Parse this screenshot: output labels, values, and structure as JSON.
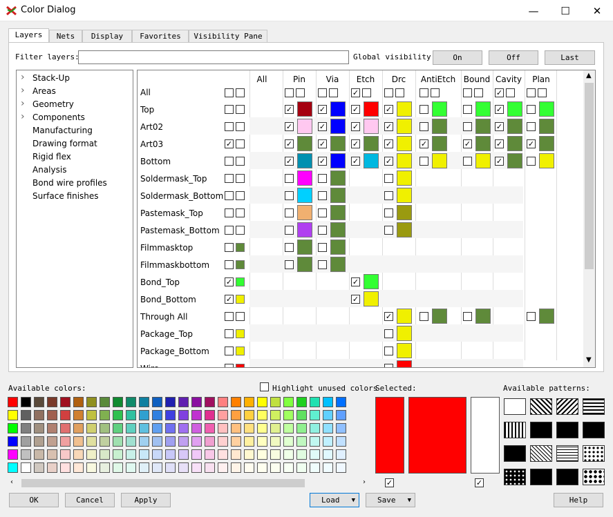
{
  "window": {
    "title": "Color Dialog",
    "minimize": "—",
    "maximize": "☐",
    "close": "✕"
  },
  "tabs": [
    "Layers",
    "Nets",
    "Display",
    "Favorites",
    "Visibility Pane"
  ],
  "filter": {
    "label": "Filter layers:",
    "value": ""
  },
  "global_visibility": {
    "label": "Global visibility:",
    "on": "On",
    "off": "Off",
    "last": "Last"
  },
  "tree": [
    {
      "label": "Stack-Up",
      "expandable": true
    },
    {
      "label": "Areas",
      "expandable": true
    },
    {
      "label": "Geometry",
      "expandable": true
    },
    {
      "label": "Components",
      "expandable": true
    },
    {
      "label": "Manufacturing",
      "expandable": false
    },
    {
      "label": "Drawing format",
      "expandable": false
    },
    {
      "label": "Rigid flex",
      "expandable": false
    },
    {
      "label": "Analysis",
      "expandable": false
    },
    {
      "label": "Bond wire profiles",
      "expandable": false
    },
    {
      "label": "Surface finishes",
      "expandable": false
    }
  ],
  "columns": [
    "All",
    "Pin",
    "Via",
    "Etch",
    "Drc",
    "AntiEtch",
    "Bound",
    "Cavity",
    "Plan"
  ],
  "rows": [
    {
      "name": "All",
      "all": [
        0,
        0
      ],
      "cells": [
        [
          0,
          null
        ],
        [
          0,
          null
        ],
        [
          1,
          null
        ],
        [
          0,
          null
        ],
        [
          0,
          null
        ],
        [
          0,
          null
        ],
        [
          1,
          null
        ],
        [
          0,
          null
        ]
      ]
    },
    {
      "name": "Top",
      "all": [
        0,
        0
      ],
      "cells": [
        [
          1,
          "#a50010"
        ],
        [
          1,
          "#0000ff"
        ],
        [
          1,
          "#ff0000"
        ],
        [
          1,
          "#f0f000"
        ],
        [
          0,
          "#33ff33"
        ],
        [
          0,
          "#33ff33"
        ],
        [
          1,
          "#33ff33"
        ],
        [
          0,
          "#33ff33"
        ]
      ]
    },
    {
      "name": "Art02",
      "all": [
        0,
        0
      ],
      "cells": [
        [
          1,
          "#ffc8f0"
        ],
        [
          1,
          "#0000ff"
        ],
        [
          1,
          "#ffc8f0"
        ],
        [
          1,
          "#f0f000"
        ],
        [
          0,
          "#5f8a3a"
        ],
        [
          0,
          "#5f8a3a"
        ],
        [
          1,
          "#5f8a3a"
        ],
        [
          0,
          "#5f8a3a"
        ]
      ]
    },
    {
      "name": "Art03",
      "all": [
        1,
        0
      ],
      "cells": [
        [
          1,
          "#5f8a3a"
        ],
        [
          1,
          "#5f8a3a"
        ],
        [
          1,
          "#5f8a3a"
        ],
        [
          1,
          "#f0f000"
        ],
        [
          1,
          "#5f8a3a"
        ],
        [
          1,
          "#5f8a3a"
        ],
        [
          1,
          "#5f8a3a"
        ],
        [
          1,
          "#5f8a3a"
        ]
      ]
    },
    {
      "name": "Bottom",
      "all": [
        0,
        0
      ],
      "cells": [
        [
          1,
          "#0090b0"
        ],
        [
          1,
          "#0000ff"
        ],
        [
          1,
          "#00b8e0"
        ],
        [
          1,
          "#f0f000"
        ],
        [
          0,
          "#f0f000"
        ],
        [
          0,
          "#f0f000"
        ],
        [
          1,
          "#5f8a3a"
        ],
        [
          0,
          "#f0f000"
        ]
      ]
    },
    {
      "name": "Soldermask_Top",
      "all": [
        0,
        0
      ],
      "cells": [
        [
          0,
          "#ff00ff"
        ],
        [
          0,
          "#5f8a3a"
        ],
        null,
        [
          0,
          "#f0f000"
        ],
        null,
        null,
        null,
        null
      ]
    },
    {
      "name": "Soldermask_Bottom",
      "all": [
        0,
        0
      ],
      "cells": [
        [
          0,
          "#00d0ff"
        ],
        [
          0,
          "#5f8a3a"
        ],
        null,
        [
          0,
          "#f0f000"
        ],
        null,
        null,
        null,
        null
      ]
    },
    {
      "name": "Pastemask_Top",
      "all": [
        0,
        0
      ],
      "cells": [
        [
          0,
          "#f0b070"
        ],
        [
          0,
          "#5f8a3a"
        ],
        null,
        [
          0,
          "#9a9a10"
        ],
        null,
        null,
        null,
        null
      ]
    },
    {
      "name": "Pastemask_Bottom",
      "all": [
        0,
        0
      ],
      "cells": [
        [
          0,
          "#b040f0"
        ],
        [
          0,
          "#5f8a3a"
        ],
        null,
        [
          0,
          "#9a9a10"
        ],
        null,
        null,
        null,
        null
      ]
    },
    {
      "name": "Filmmasktop",
      "all": [
        0,
        "#5f8a3a"
      ],
      "cells": [
        [
          0,
          "#5f8a3a"
        ],
        [
          0,
          "#5f8a3a"
        ],
        null,
        null,
        null,
        null,
        null,
        null
      ]
    },
    {
      "name": "Filmmaskbottom",
      "all": [
        0,
        "#5f8a3a"
      ],
      "cells": [
        [
          0,
          "#5f8a3a"
        ],
        [
          0,
          "#5f8a3a"
        ],
        null,
        null,
        null,
        null,
        null,
        null
      ]
    },
    {
      "name": "Bond_Top",
      "all": [
        1,
        "#33ff33"
      ],
      "cells": [
        null,
        null,
        [
          1,
          "#33ff33"
        ],
        null,
        null,
        null,
        null,
        null
      ]
    },
    {
      "name": "Bond_Bottom",
      "all": [
        1,
        "#f0f000"
      ],
      "cells": [
        null,
        null,
        [
          1,
          "#f0f000"
        ],
        null,
        null,
        null,
        null,
        null
      ]
    },
    {
      "name": "Through All",
      "all": [
        0,
        0
      ],
      "cells": [
        null,
        null,
        null,
        [
          1,
          "#f0f000"
        ],
        [
          0,
          "#5f8a3a"
        ],
        [
          0,
          "#5f8a3a"
        ],
        null,
        [
          0,
          "#5f8a3a"
        ]
      ]
    },
    {
      "name": "Package_Top",
      "all": [
        0,
        "#f0f000"
      ],
      "cells": [
        null,
        null,
        null,
        [
          0,
          "#f0f000"
        ],
        null,
        null,
        null,
        null
      ]
    },
    {
      "name": "Package_Bottom",
      "all": [
        0,
        "#f0f000"
      ],
      "cells": [
        null,
        null,
        null,
        [
          0,
          "#f0f000"
        ],
        null,
        null,
        null,
        null
      ]
    },
    {
      "name": "Wire",
      "all": [
        0,
        "#ff0000"
      ],
      "cells": [
        null,
        null,
        null,
        [
          0,
          "#ff0000"
        ],
        null,
        null,
        null,
        null
      ]
    }
  ],
  "available_colors_label": "Available colors:",
  "highlight_unused": {
    "label": "Highlight unused colors",
    "checked": false
  },
  "selected_label": "Selected:",
  "selected_color": "#ff0000",
  "patterns_label": "Available patterns:",
  "palette": [
    [
      "#ff0000",
      "#000000",
      "#5a4a3a",
      "#7a3a2a",
      "#a01020",
      "#b06010",
      "#909020",
      "#5a8a3a",
      "#108a30",
      "#108a6a",
      "#1080a0",
      "#1060c0",
      "#2020b0",
      "#6020b0",
      "#8a10a0",
      "#a01060",
      "#ff8080",
      "#ff8000",
      "#ffb000",
      "#ffff00",
      "#c0e040",
      "#80ff40",
      "#20d020",
      "#20e0b0",
      "#00c0ff",
      "#0070ff"
    ],
    [
      "#ffff00",
      "#606060",
      "#907060",
      "#a06050",
      "#d04040",
      "#d08030",
      "#c0c040",
      "#80b050",
      "#30c050",
      "#30c0a0",
      "#30a0d0",
      "#3080e0",
      "#4040e0",
      "#8040e0",
      "#c030d0",
      "#e03090",
      "#ffa0a0",
      "#ffa040",
      "#ffd040",
      "#ffff60",
      "#d0f060",
      "#a0ff60",
      "#60e060",
      "#60f0d0",
      "#60d0ff",
      "#60a0ff"
    ],
    [
      "#00ff00",
      "#808080",
      "#a09080",
      "#b08070",
      "#e07070",
      "#e0a060",
      "#d0d070",
      "#a0c080",
      "#60d080",
      "#60d0c0",
      "#60c0e0",
      "#60a0f0",
      "#7070f0",
      "#a070f0",
      "#d060e0",
      "#f060b0",
      "#ffc0c0",
      "#ffc080",
      "#ffe080",
      "#ffff90",
      "#e0f090",
      "#c0ffa0",
      "#90f090",
      "#90f0e0",
      "#90e0ff",
      "#90c0ff"
    ],
    [
      "#0000ff",
      "#a0a0a0",
      "#b0a090",
      "#c0a090",
      "#f0a0a0",
      "#f0c090",
      "#e0e0a0",
      "#c0d0a0",
      "#a0e0b0",
      "#a0e0d0",
      "#a0d0f0",
      "#a0c0f0",
      "#a0a0f0",
      "#c0a0f0",
      "#e0a0f0",
      "#f0a0d0",
      "#ffd0d0",
      "#ffd0a0",
      "#fff0a0",
      "#ffffc0",
      "#f0f8c0",
      "#e0ffd0",
      "#c0f8c0",
      "#c0f8f0",
      "#c0f0ff",
      "#c0e0ff"
    ],
    [
      "#ff00ff",
      "#c0c0c0",
      "#c8b8a8",
      "#d8c0b0",
      "#f8c8c8",
      "#f8d8b8",
      "#f0f0c8",
      "#d8e8c8",
      "#c8f0d0",
      "#c8f0e8",
      "#c8e8f8",
      "#c8d8f8",
      "#c8c8f8",
      "#d8c8f8",
      "#f0c8f8",
      "#f8c8e8",
      "#ffe0e0",
      "#ffe8d0",
      "#fff8d0",
      "#ffffe0",
      "#f8fce0",
      "#f0ffe8",
      "#e0fce0",
      "#e0fcf8",
      "#e0f8ff",
      "#e0f0ff"
    ],
    [
      "#00ffff",
      "#ffffff",
      "#d0c8c0",
      "#e8d0c8",
      "#ffe0e0",
      "#ffe8d8",
      "#f8f8e0",
      "#e8f0e0",
      "#e0f8e8",
      "#e0f8f0",
      "#e0f0f8",
      "#e0e8f8",
      "#e0e0f8",
      "#e8e0f8",
      "#f8e0f8",
      "#f8e0f0",
      "#fff0f0",
      "#fff4e8",
      "#fffcf0",
      "#fffff0",
      "#fcfef0",
      "#f8fff4",
      "#f0fef0",
      "#f0fefc",
      "#f0fcff",
      "#f0f8ff"
    ]
  ],
  "buttons": {
    "ok": "OK",
    "cancel": "Cancel",
    "apply": "Apply",
    "load": "Load",
    "save": "Save",
    "help": "Help"
  }
}
